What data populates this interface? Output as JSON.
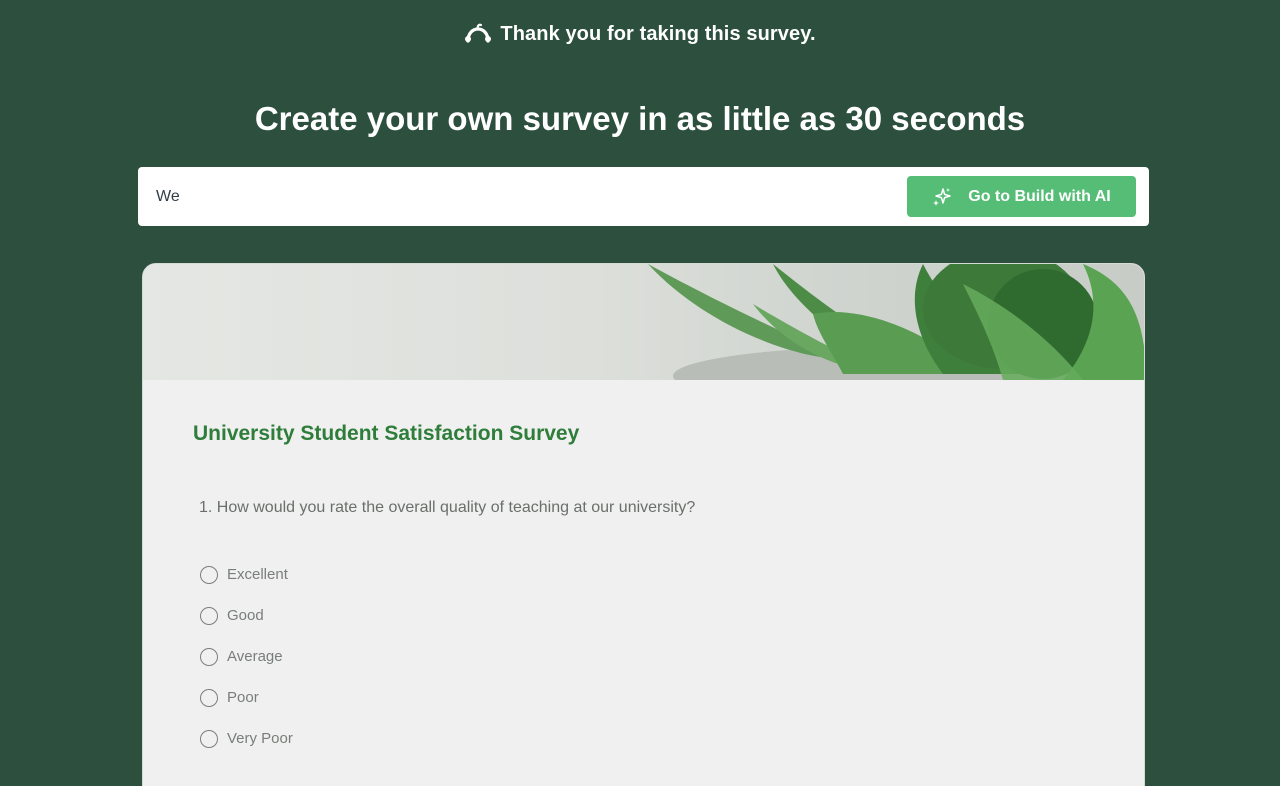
{
  "header": {
    "thanks_text": "Thank you for taking this survey.",
    "logo_icon": "surveymonkey-logo-icon"
  },
  "hero": {
    "headline": "Create your own survey in as little as 30 seconds"
  },
  "prompt": {
    "input_value": "We",
    "button_label": "Go to Build with AI",
    "button_icon": "sparkle-icon",
    "button_color": "#56bd77"
  },
  "survey": {
    "title": "University Student Satisfaction Survey",
    "title_color": "#2f7d3a",
    "question": "1. How would you rate the overall quality of teaching at our university?",
    "options": [
      "Excellent",
      "Good",
      "Average",
      "Poor",
      "Very Poor"
    ]
  },
  "colors": {
    "background": "#2c4f3e",
    "card": "#eff0ef"
  }
}
